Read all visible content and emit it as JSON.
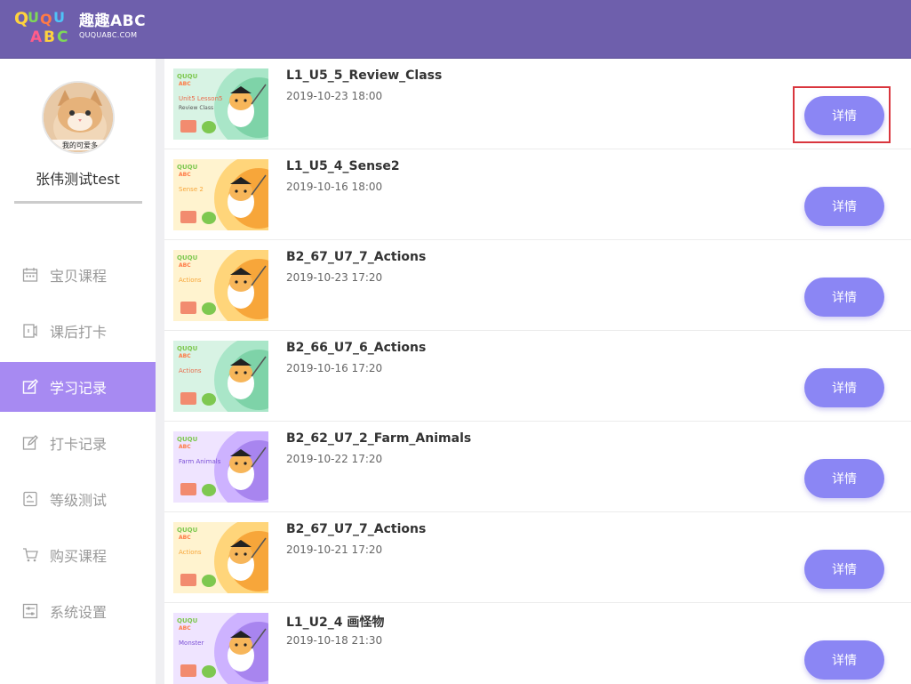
{
  "header": {
    "logo_word": "QUQU ABC",
    "logo_cn": "趣趣ABC",
    "logo_url": "QUQUABC.COM"
  },
  "profile": {
    "username": "张伟测试test",
    "avatar_caption": "我的可爱多"
  },
  "nav": [
    {
      "label": "宝贝课程",
      "icon": "calendar-icon",
      "active": false
    },
    {
      "label": "课后打卡",
      "icon": "checkin-icon",
      "active": false
    },
    {
      "label": "学习记录",
      "icon": "edit-icon",
      "active": true
    },
    {
      "label": "打卡记录",
      "icon": "edit-icon",
      "active": false
    },
    {
      "label": "等级测试",
      "icon": "test-icon",
      "active": false
    },
    {
      "label": "购买课程",
      "icon": "cart-icon",
      "active": false
    },
    {
      "label": "系统设置",
      "icon": "settings-icon",
      "active": false
    }
  ],
  "records": [
    {
      "title": "L1_U5_5_Review_Class",
      "time": "2019-10-23 18:00",
      "button": "详情",
      "thumb_label": "Unit5 Lesson5",
      "thumb_sub": "Review Class",
      "theme": "green"
    },
    {
      "title": "L1_U5_4_Sense2",
      "time": "2019-10-16 18:00",
      "button": "详情",
      "thumb_label": "Sense 2",
      "thumb_sub": "",
      "theme": "orange"
    },
    {
      "title": "B2_67_U7_7_Actions",
      "time": "2019-10-23 17:20",
      "button": "详情",
      "thumb_label": "Actions",
      "thumb_sub": "",
      "theme": "orange"
    },
    {
      "title": "B2_66_U7_6_Actions",
      "time": "2019-10-16 17:20",
      "button": "详情",
      "thumb_label": "Actions",
      "thumb_sub": "",
      "theme": "green"
    },
    {
      "title": "B2_62_U7_2_Farm_Animals",
      "time": "2019-10-22 17:20",
      "button": "详情",
      "thumb_label": "Farm Animals",
      "thumb_sub": "",
      "theme": "purple"
    },
    {
      "title": "B2_67_U7_7_Actions",
      "time": "2019-10-21 17:20",
      "button": "详情",
      "thumb_label": "Actions",
      "thumb_sub": "",
      "theme": "orange"
    },
    {
      "title": "L1_U2_4 画怪物",
      "time": "2019-10-18 21:30",
      "button": "详情",
      "thumb_label": "Monster",
      "thumb_sub": "",
      "theme": "purple"
    }
  ],
  "colors": {
    "header": "#6e5fac",
    "active_nav": "#a78af2",
    "button": "#8b86f4",
    "highlight": "#d9363e"
  }
}
